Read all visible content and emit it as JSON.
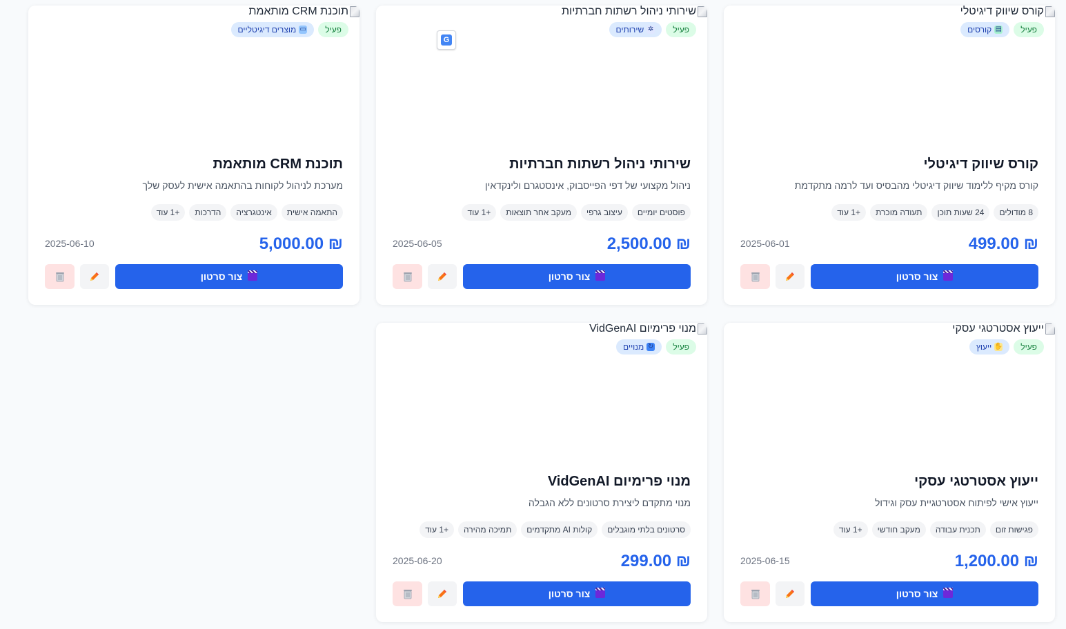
{
  "common": {
    "active_label": "פעיל",
    "video_button_label": "צור סרטון"
  },
  "products": [
    {
      "image_alt": "קורס שיווק דיגיטלי",
      "category": "קורסים",
      "category_icon": "books-icon",
      "title": "קורס שיווק דיגיטלי",
      "description": "קורס מקיף ללימוד שיווק דיגיטלי מהבסיס ועד לרמה מתקדמת",
      "tags": [
        "8 מודולים",
        "24 שעות תוכן",
        "תעודה מוכרת",
        "+1 עוד"
      ],
      "price": "₪ 499.00",
      "date": "2025-06-01"
    },
    {
      "image_alt": "שירותי ניהול רשתות חברתיות",
      "category": "שירותים",
      "category_icon": "gear-icon",
      "title": "שירותי ניהול רשתות חברתיות",
      "description": "ניהול מקצועי של דפי הפייסבוק, אינסטגרם ולינקדאין",
      "tags": [
        "פוסטים יומיים",
        "עיצוב גרפי",
        "מעקב אחר תוצאות",
        "+1 עוד"
      ],
      "price": "₪ 2,500.00",
      "date": "2025-06-05"
    },
    {
      "image_alt": "תוכנת CRM מותאמת",
      "category": "מוצרים דיגיטליים",
      "category_icon": "computer-icon",
      "title": "תוכנת CRM מותאמת",
      "description": "מערכת לניהול לקוחות בהתאמה אישית לעסק שלך",
      "tags": [
        "התאמה אישית",
        "אינטגרציה",
        "הדרכות",
        "+1 עוד"
      ],
      "price": "₪ 5,000.00",
      "date": "2025-06-10"
    },
    {
      "image_alt": "ייעוץ אסטרטגי עסקי",
      "category": "ייעוץ",
      "category_icon": "handshake-icon",
      "title": "ייעוץ אסטרטגי עסקי",
      "description": "ייעוץ אישי לפיתוח אסטרטגיית עסק וגידול",
      "tags": [
        "פגישות זום",
        "תכנית עבודה",
        "מעקב חודשי",
        "+1 עוד"
      ],
      "price": "₪ 1,200.00",
      "date": "2025-06-15"
    },
    {
      "image_alt": "מנוי פרימיום VidGenAI",
      "category": "מנויים",
      "category_icon": "refresh-icon",
      "title": "מנוי פרימיום VidGenAI",
      "description": "מנוי מתקדם ליצירת סרטונים ללא הגבלה",
      "tags": [
        "סרטונים בלתי מוגבלים",
        "קולות AI מתקדמים",
        "תמיכה מהירה",
        "+1 עוד"
      ],
      "price": "₪ 299.00",
      "date": "2025-06-20"
    }
  ],
  "colors": {
    "accent": "#2563eb",
    "active_badge_bg": "#dcfce7",
    "active_badge_text": "#15803d",
    "category_badge_bg": "#dbeafe",
    "delete_bg": "#fee2e2"
  }
}
